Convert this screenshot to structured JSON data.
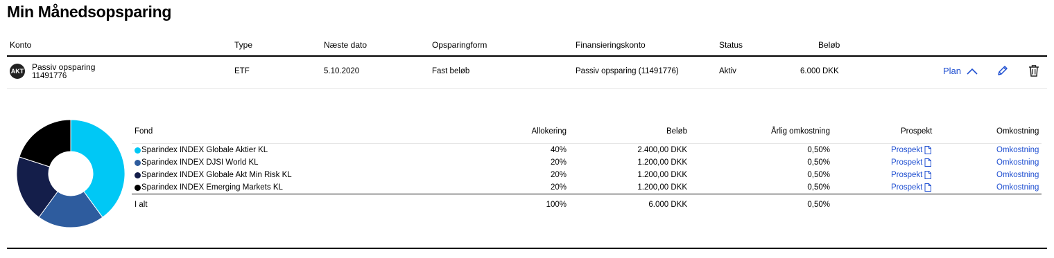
{
  "page": {
    "title": "Min Månedsopsparing"
  },
  "columns": {
    "konto": "Konto",
    "type": "Type",
    "naeste_dato": "Næste dato",
    "opsparingform": "Opsparingform",
    "finansieringskonto": "Finansieringskonto",
    "status": "Status",
    "beloeb": "Beløb"
  },
  "row": {
    "avatar": "AKT",
    "name": "Passiv opsparing",
    "number": "11491776",
    "type": "ETF",
    "date": "5.10.2020",
    "form": "Fast beløb",
    "funding": "Passiv opsparing (11491776)",
    "status": "Aktiv",
    "amount": "6.000 DKK",
    "plan_label": "Plan",
    "edit_icon": "pencil-icon",
    "delete_icon": "trash-icon"
  },
  "funds": {
    "headers": {
      "fond": "Fond",
      "allokering": "Allokering",
      "beloeb": "Beløb",
      "omkostning": "Årlig omkostning",
      "prospekt": "Prospekt",
      "omk_link": "Omkostning"
    },
    "rows": [
      {
        "name": "Sparindex INDEX Globale Aktier KL",
        "alloc": "40%",
        "amount": "2.400,00 DKK",
        "cost": "0,50%",
        "prospekt": "Prospekt",
        "omk": "Omkostning",
        "color": "#00c8f5",
        "share": 40
      },
      {
        "name": "Sparindex INDEX DJSI World KL",
        "alloc": "20%",
        "amount": "1.200,00 DKK",
        "cost": "0,50%",
        "prospekt": "Prospekt",
        "omk": "Omkostning",
        "color": "#2e5c9e",
        "share": 20
      },
      {
        "name": "Sparindex INDEX Globale Akt Min Risk KL",
        "alloc": "20%",
        "amount": "1.200,00 DKK",
        "cost": "0,50%",
        "prospekt": "Prospekt",
        "omk": "Omkostning",
        "color": "#141e4a",
        "share": 20
      },
      {
        "name": "Sparindex INDEX Emerging Markets KL",
        "alloc": "20%",
        "amount": "1.200,00 DKK",
        "cost": "0,50%",
        "prospekt": "Prospekt",
        "omk": "Omkostning",
        "color": "#000000",
        "share": 20
      }
    ],
    "total": {
      "label": "I alt",
      "alloc": "100%",
      "amount": "6.000 DKK",
      "cost": "0,50%"
    }
  }
}
